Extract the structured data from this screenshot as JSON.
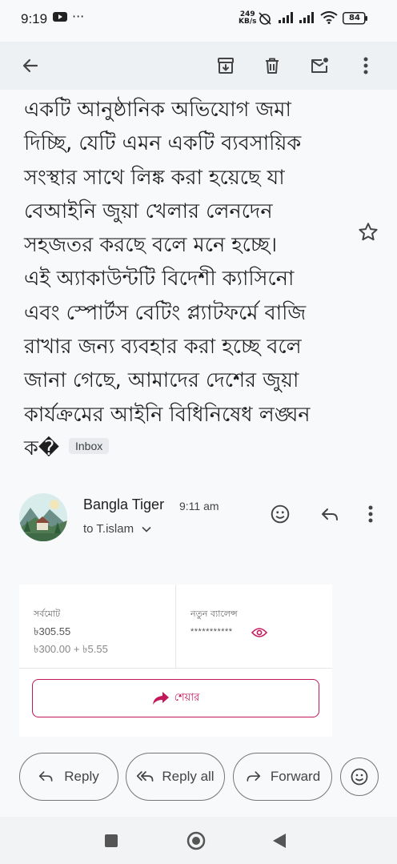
{
  "status_bar": {
    "time": "9:19",
    "network_speed_value": "249",
    "network_speed_unit": "KB/s",
    "battery": "84"
  },
  "subject_lines": [
    "একটি আনুষ্ঠানিক অভিযোগ জমা",
    "দিচ্ছি, যেটি এমন একটি ব্যবসায়িক",
    "সংস্থার সাথে লিঙ্ক করা হয়েছে যা",
    "বেআইনি জুয়া খেলার লেনদেন",
    "সহজতর করছে বলে মনে হচ্ছে।",
    "এই অ্যাকাউন্টটি বিদেশী ক্যাসিনো",
    "এবং স্পোর্টস বেটিং প্ল্যাটফর্মে বাজি",
    "রাখার জন্য ব্যবহার করা হচ্ছে বলে",
    "জানা গেছে, আমাদের দেশের জুয়া",
    "কার্যক্রমের আইনি বিধিনিষেধ লঙ্ঘন",
    "ক�"
  ],
  "inbox_chip": "Inbox",
  "message": {
    "sender": "Bangla Tiger",
    "time": "9:11 am",
    "to": "to T.islam"
  },
  "card": {
    "total_label": "সর্বমোট",
    "total_amount": "৳305.55",
    "total_breakdown": "৳300.00 + ৳5.55",
    "balance_label": "নতুন ব্যালেন্স",
    "balance_value": "***********",
    "share_label": "শেয়ার"
  },
  "actions": {
    "reply": "Reply",
    "reply_all": "Reply all",
    "forward": "Forward"
  },
  "colors": {
    "accent": "#c2185b",
    "appbar_bg": "#eef1f4",
    "background": "#f7f9fb"
  }
}
